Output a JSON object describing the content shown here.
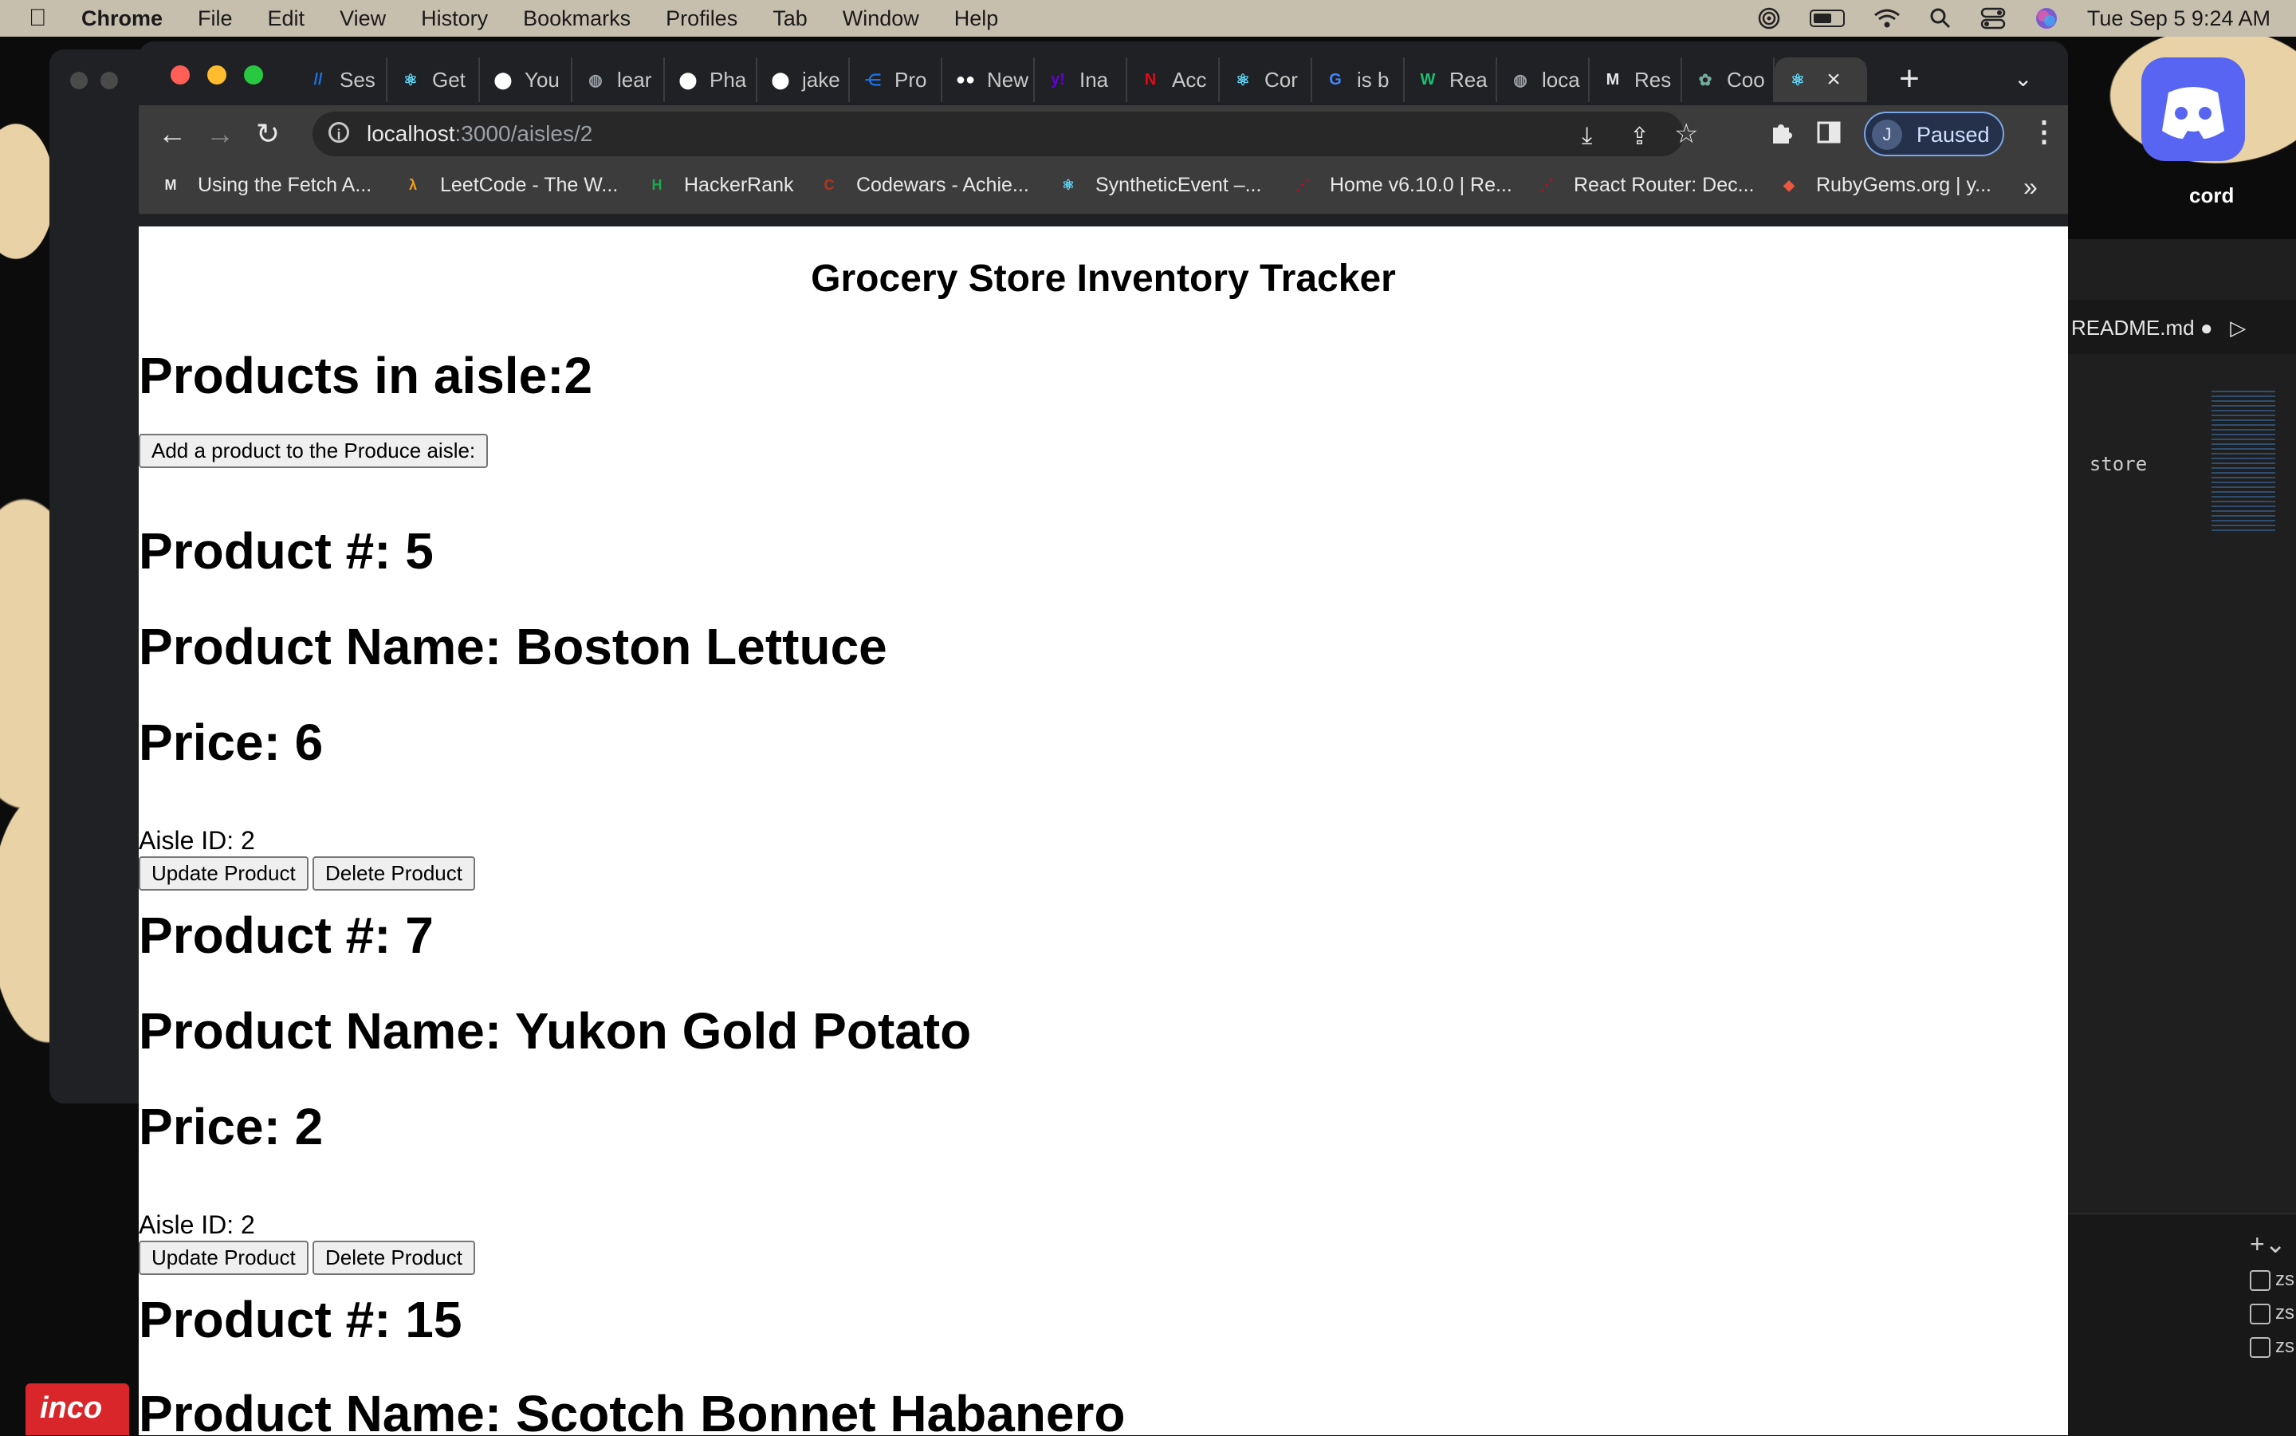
{
  "menubar": {
    "apple": "",
    "items": [
      "Chrome",
      "File",
      "Edit",
      "View",
      "History",
      "Bookmarks",
      "Profiles",
      "Tab",
      "Window",
      "Help"
    ],
    "datetime": "Tue Sep 5  9:24 AM"
  },
  "tabs": [
    {
      "label": "Ses",
      "icon": "slash-icon",
      "color": "#1a73e8"
    },
    {
      "label": "Get",
      "icon": "react-icon",
      "color": "#61dafb"
    },
    {
      "label": "You",
      "icon": "github-icon",
      "color": "#ffffff"
    },
    {
      "label": "lear",
      "icon": "globe-icon",
      "color": "#9aa0a6"
    },
    {
      "label": "Pha",
      "icon": "github-icon",
      "color": "#ffffff"
    },
    {
      "label": "jake",
      "icon": "github-icon",
      "color": "#ffffff"
    },
    {
      "label": "Pro",
      "icon": "share-icon",
      "color": "#1a73e8"
    },
    {
      "label": "New",
      "icon": "medium-icon",
      "color": "#ffffff"
    },
    {
      "label": "Ina",
      "icon": "yahoo-icon",
      "color": "#6001d2"
    },
    {
      "label": "Acc",
      "icon": "netflix-icon",
      "color": "#e50914"
    },
    {
      "label": "Cor",
      "icon": "react-icon",
      "color": "#61dafb"
    },
    {
      "label": "is b",
      "icon": "google-icon",
      "color": "#4285f4"
    },
    {
      "label": "Rea",
      "icon": "w-icon",
      "color": "#1dbf73"
    },
    {
      "label": "loca",
      "icon": "globe-icon",
      "color": "#9aa0a6"
    },
    {
      "label": "Res",
      "icon": "m-slash-icon",
      "color": "#e8e8e8"
    },
    {
      "label": "Coo",
      "icon": "openai-icon",
      "color": "#74aa9c"
    },
    {
      "label": "",
      "icon": "react-icon",
      "color": "#61dafb",
      "active": true
    }
  ],
  "url": {
    "host": "localhost",
    "path": ":3000/aisles/2"
  },
  "profile": {
    "initial": "J",
    "status": "Paused"
  },
  "bookmarks": [
    {
      "label": "Using the Fetch A...",
      "icon": "m-slash-icon"
    },
    {
      "label": "LeetCode - The W...",
      "icon": "leetcode-icon"
    },
    {
      "label": "HackerRank",
      "icon": "hackerrank-icon"
    },
    {
      "label": "Codewars - Achie...",
      "icon": "codewars-icon"
    },
    {
      "label": "SyntheticEvent –...",
      "icon": "react-icon"
    },
    {
      "label": "Home v6.10.0 | Re...",
      "icon": "router-icon"
    },
    {
      "label": "React Router: Dec...",
      "icon": "router-icon"
    },
    {
      "label": "RubyGems.org | y...",
      "icon": "rubygems-icon"
    }
  ],
  "page": {
    "title": "Grocery Store Inventory Tracker",
    "aisle_heading": "Products in aisle:2",
    "add_button": "Add a product to the Produce aisle:",
    "products": [
      {
        "number": "Product #: 5",
        "name": "Product Name: Boston Lettuce",
        "price": "Price: 6",
        "aisle": "Aisle ID: 2",
        "update": "Update Product",
        "delete": "Delete Product"
      },
      {
        "number": "Product #: 7",
        "name": "Product Name: Yukon Gold Potato",
        "price": "Price: 2",
        "aisle": "Aisle ID: 2",
        "update": "Update Product",
        "delete": "Delete Product"
      },
      {
        "number": "Product #: 15",
        "name": "Product Name: Scotch Bonnet Habanero"
      }
    ]
  },
  "vscode": {
    "tab": "README.md",
    "snippet": "store",
    "partial_label": "cord",
    "terminal_items": [
      "zs",
      "zs",
      "zs"
    ]
  }
}
